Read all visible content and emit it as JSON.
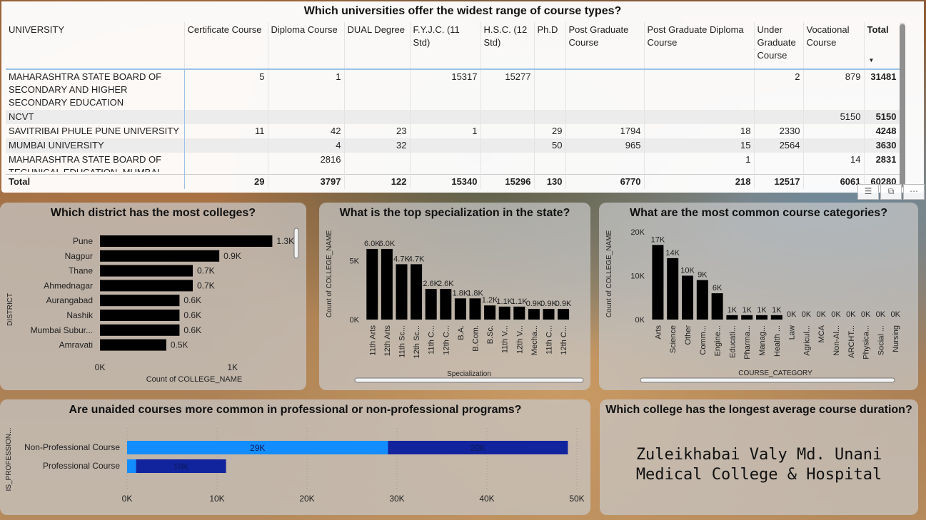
{
  "table": {
    "title": "Which universities offer the widest range of course types?",
    "columns": [
      "UNIVERSITY",
      "Certificate Course",
      "Diploma Course",
      "DUAL Degree",
      "F.Y.J.C. (11 Std)",
      "H.S.C. (12 Std)",
      "Ph.D",
      "Post Graduate Course",
      "Post Graduate Diploma Course",
      "Under Graduate Course",
      "Vocational Course",
      "Total"
    ],
    "rows": [
      [
        "MAHARASHTRA STATE BOARD OF SECONDARY AND HIGHER SECONDARY EDUCATION",
        "5",
        "1",
        "",
        "15317",
        "15277",
        "",
        "",
        "",
        "2",
        "879",
        "31481"
      ],
      [
        "NCVT",
        "",
        "",
        "",
        "",
        "",
        "",
        "",
        "",
        "",
        "5150",
        "5150"
      ],
      [
        "SAVITRIBAI PHULE PUNE UNIVERSITY",
        "11",
        "42",
        "23",
        "1",
        "",
        "29",
        "1794",
        "18",
        "2330",
        "",
        "4248"
      ],
      [
        "MUMBAI UNIVERSITY",
        "",
        "4",
        "32",
        "",
        "",
        "50",
        "965",
        "15",
        "2564",
        "",
        "3630"
      ],
      [
        "MAHARASHTRA STATE BOARD OF TECHNICAL EDUCATION, MUMBAI",
        "",
        "2816",
        "",
        "",
        "",
        "",
        "",
        "1",
        "",
        "14",
        "2831"
      ]
    ],
    "total_row": [
      "Total",
      "29",
      "3797",
      "122",
      "15340",
      "15296",
      "130",
      "6770",
      "218",
      "12517",
      "6061",
      "60280"
    ],
    "toolbar_icons": [
      "filter-icon",
      "focus-mode-icon",
      "more-options-icon"
    ]
  },
  "charts": {
    "district": {
      "title": "Which district has the most colleges?"
    },
    "specialization": {
      "title": "What is the top specialization in the state?"
    },
    "category": {
      "title": "What are the most common course categories?"
    },
    "unaided": {
      "title": "Are unaided courses more common in professional or non-professional programs?"
    }
  },
  "duration": {
    "title": "Which college has the longest average course duration?",
    "answer": "Zuleikhabai Valy Md. Unani Medical College & Hospital"
  },
  "chart_data": [
    {
      "type": "bar",
      "orientation": "horizontal",
      "title": "Which district has the most colleges?",
      "xlabel": "Count of COLLEGE_NAME",
      "ylabel": "DISTRICT",
      "categories": [
        "Pune",
        "Nagpur",
        "Thane",
        "Ahmednagar",
        "Aurangabad",
        "Nashik",
        "Mumbai Subur...",
        "Amravati"
      ],
      "values": [
        1300,
        900,
        700,
        700,
        600,
        600,
        600,
        500
      ],
      "labels": [
        "1.3K",
        "0.9K",
        "0.7K",
        "0.7K",
        "0.6K",
        "0.6K",
        "0.6K",
        "0.5K"
      ],
      "xlim": [
        0,
        1400
      ],
      "xticks": [
        {
          "v": 0,
          "t": "0K"
        },
        {
          "v": 1000,
          "t": "1K"
        }
      ],
      "color": "#000000"
    },
    {
      "type": "bar",
      "title": "What is the top specialization in the state?",
      "xlabel": "Specialization",
      "ylabel": "Count of COLLEGE_NAME",
      "categories": [
        "11th Arts",
        "12th Arts",
        "11th Sc...",
        "12th Sc...",
        "11th C...",
        "12th C...",
        "B.A.",
        "B.Com.",
        "B.Sc.",
        "11th V...",
        "12th V...",
        "Mecha...",
        "11th C...",
        "12th C..."
      ],
      "values": [
        6000,
        6000,
        4700,
        4700,
        2600,
        2600,
        1800,
        1800,
        1200,
        1100,
        1100,
        900,
        900,
        900
      ],
      "labels": [
        "6.0K",
        "6.0K",
        "4.7K",
        "4.7K",
        "2.6K",
        "2.6K",
        "1.8K",
        "1.8K",
        "1.2K",
        "1.1K",
        "1.1K",
        "0.9K",
        "0.9K",
        "0.9K"
      ],
      "ylim": [
        0,
        6300
      ],
      "yticks": [
        {
          "v": 0,
          "t": "0K"
        },
        {
          "v": 5000,
          "t": "5K"
        }
      ],
      "color": "#000000"
    },
    {
      "type": "bar",
      "title": "What are the most common course categories?",
      "xlabel": "COURSE_CATEGORY",
      "ylabel": "Count of COLLEGE_NAME",
      "categories": [
        "Arts",
        "Science",
        "Other",
        "Comm...",
        "Engine...",
        "Educati...",
        "Pharma...",
        "Manag...",
        "Health ...",
        "Law",
        "Agricul...",
        "MCA",
        "Non-Al...",
        "ARCHT...",
        "Physica...",
        "Social ...",
        "Nursing"
      ],
      "values": [
        17000,
        14000,
        10000,
        9000,
        6000,
        1000,
        1000,
        1000,
        1000,
        0,
        0,
        0,
        0,
        0,
        0,
        0,
        0
      ],
      "labels": [
        "17K",
        "14K",
        "10K",
        "9K",
        "6K",
        "1K",
        "1K",
        "1K",
        "1K",
        "0K",
        "0K",
        "0K",
        "0K",
        "0K",
        "0K",
        "0K",
        "0K"
      ],
      "ylim": [
        0,
        20000
      ],
      "yticks": [
        {
          "v": 0,
          "t": "0K"
        },
        {
          "v": 10000,
          "t": "10K"
        },
        {
          "v": 20000,
          "t": "20K"
        }
      ],
      "color": "#000000"
    },
    {
      "type": "bar",
      "orientation": "horizontal",
      "stacked": true,
      "title": "Are unaided courses more common in professional or non-professional programs?",
      "ylabel": "IS_PROFESSION...",
      "categories": [
        "Non-Professional Course",
        "Professional Course"
      ],
      "series": [
        {
          "values": [
            29000,
            1000
          ],
          "labels": [
            "29K",
            ""
          ],
          "color": "#118dff"
        },
        {
          "values": [
            20000,
            10000
          ],
          "labels": [
            "20K",
            "10K"
          ],
          "color": "#12239e"
        }
      ],
      "xlim": [
        0,
        50000
      ],
      "xticks": [
        {
          "v": 0,
          "t": "0K"
        },
        {
          "v": 10000,
          "t": "10K"
        },
        {
          "v": 20000,
          "t": "20K"
        },
        {
          "v": 30000,
          "t": "30K"
        },
        {
          "v": 40000,
          "t": "40K"
        },
        {
          "v": 50000,
          "t": "50K"
        }
      ]
    }
  ]
}
